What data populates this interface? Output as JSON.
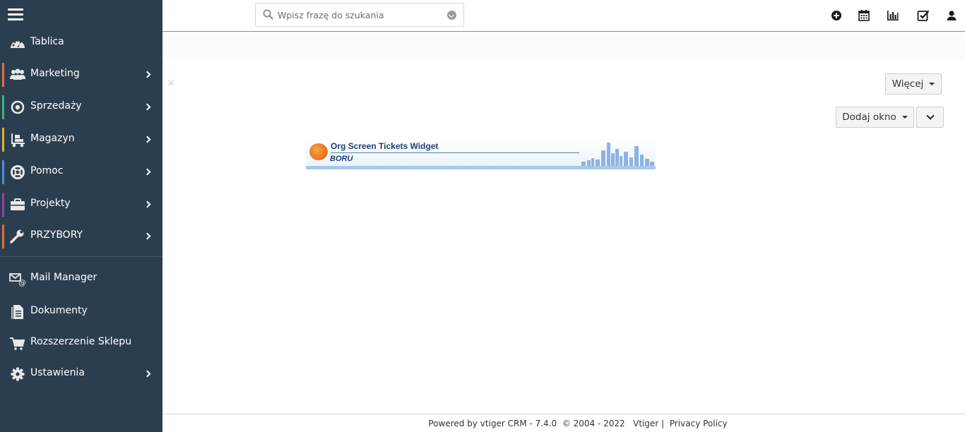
{
  "search": {
    "placeholder": "Wpisz frazę do szukania"
  },
  "header_icons": [
    "add-icon",
    "calendar-icon",
    "reports-chart-icon",
    "tasks-check-icon",
    "user-icon"
  ],
  "toolbar": {
    "more_label": "Więcej",
    "add_widget_label": "Dodaj okno"
  },
  "widget": {
    "title": "Org Screen Tickets Widget",
    "brand": "BORU"
  },
  "sidebar": {
    "items": [
      {
        "label": "Tablica",
        "icon": "dashboard-icon"
      },
      {
        "label": "Marketing",
        "icon": "users-group-icon",
        "color": "#e9693e"
      },
      {
        "label": "Sprzedaży",
        "icon": "target-icon",
        "color": "#3cb878"
      },
      {
        "label": "Magazyn",
        "icon": "dolly-icon",
        "color": "#d9b424"
      },
      {
        "label": "Pomoc",
        "icon": "lifebuoy-icon",
        "color": "#4a90d9"
      },
      {
        "label": "Projekty",
        "icon": "briefcase-icon",
        "color": "#8e44ad"
      },
      {
        "label": "PRZYBORY",
        "icon": "wrench-icon",
        "color": "#e9693e"
      }
    ],
    "extra": [
      {
        "label": "Mail Manager",
        "icon": "mail-at-icon"
      },
      {
        "label": "Dokumenty",
        "icon": "document-icon"
      },
      {
        "label": "Rozszerzenie Sklepu",
        "icon": "cart-icon"
      },
      {
        "label": "Ustawienia",
        "icon": "gear-icon"
      }
    ]
  },
  "footer": {
    "powered": "Powered by vtiger CRM - 7.4.0",
    "copyright": "© 2004 - 2022",
    "vtiger_link": "Vtiger",
    "separator": "|",
    "privacy_link": "Privacy Policy"
  }
}
